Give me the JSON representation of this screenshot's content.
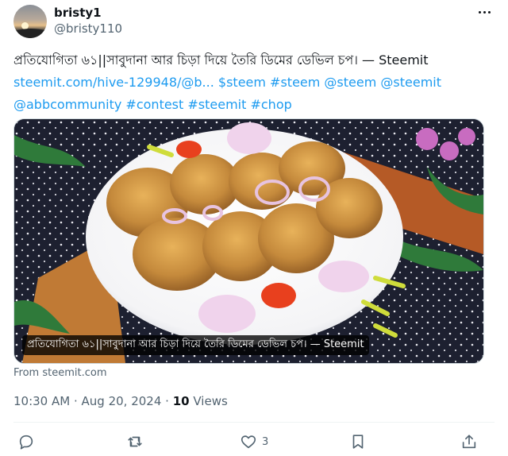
{
  "author": {
    "name": "bristy1",
    "handle": "@bristy110"
  },
  "tweet": {
    "text_plain": "প্রতিযোগিতা ৬১||সাবুদানা আর চিড়া দিয়ে তৈরি ডিমের ডেভিল চপ। — Steemit",
    "link_url": "steemit.com/hive-129948/@b...",
    "tags_line1": "$steem #steem @steem @steemit",
    "tags_line2": "@abbcommunity #contest #steemit #chop"
  },
  "card": {
    "caption": "প্রতিযোগিতা ৬১||সাবুদানা আর চিড়া দিয়ে তৈরি ডিমের ডেভিল চপ। — Steemit",
    "source": "From steemit.com"
  },
  "meta": {
    "time": "10:30 AM",
    "date": "Aug 20, 2024",
    "views_count": "10",
    "views_label": "Views"
  },
  "actions": {
    "reply_icon": "reply-icon",
    "repost_icon": "repost-icon",
    "like_icon": "like-icon",
    "like_count": "3",
    "bookmark_icon": "bookmark-icon",
    "share_icon": "share-icon"
  },
  "colors": {
    "link": "#1d9bf0",
    "secondary_text": "#536471",
    "primary_text": "#0f1419"
  }
}
